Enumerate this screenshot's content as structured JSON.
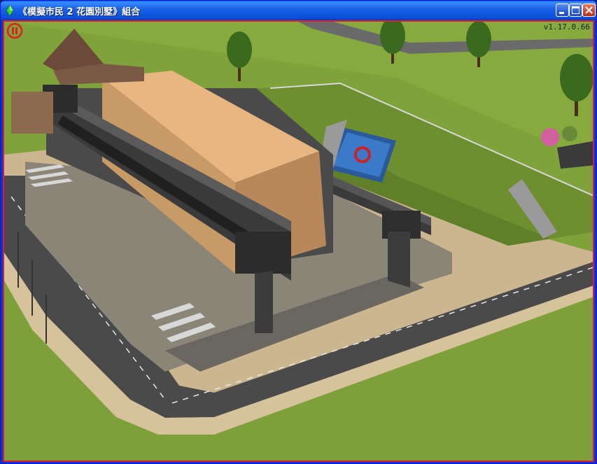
{
  "window": {
    "title": "《模擬市民 2 花園別墅》組合",
    "controls": {
      "minimize": "minimize-icon",
      "maximize": "maximize-icon",
      "close": "close-icon"
    }
  },
  "game": {
    "version": "v1.17.0.66",
    "pause_icon": "pause-icon",
    "border_color": "#e02020"
  },
  "colors": {
    "grass": "#7fa23a",
    "road": "#4a4a4a",
    "sidewalk": "#c8b48c",
    "building_roof": "#e0b07a",
    "titlebar": "#0a4fd6"
  }
}
